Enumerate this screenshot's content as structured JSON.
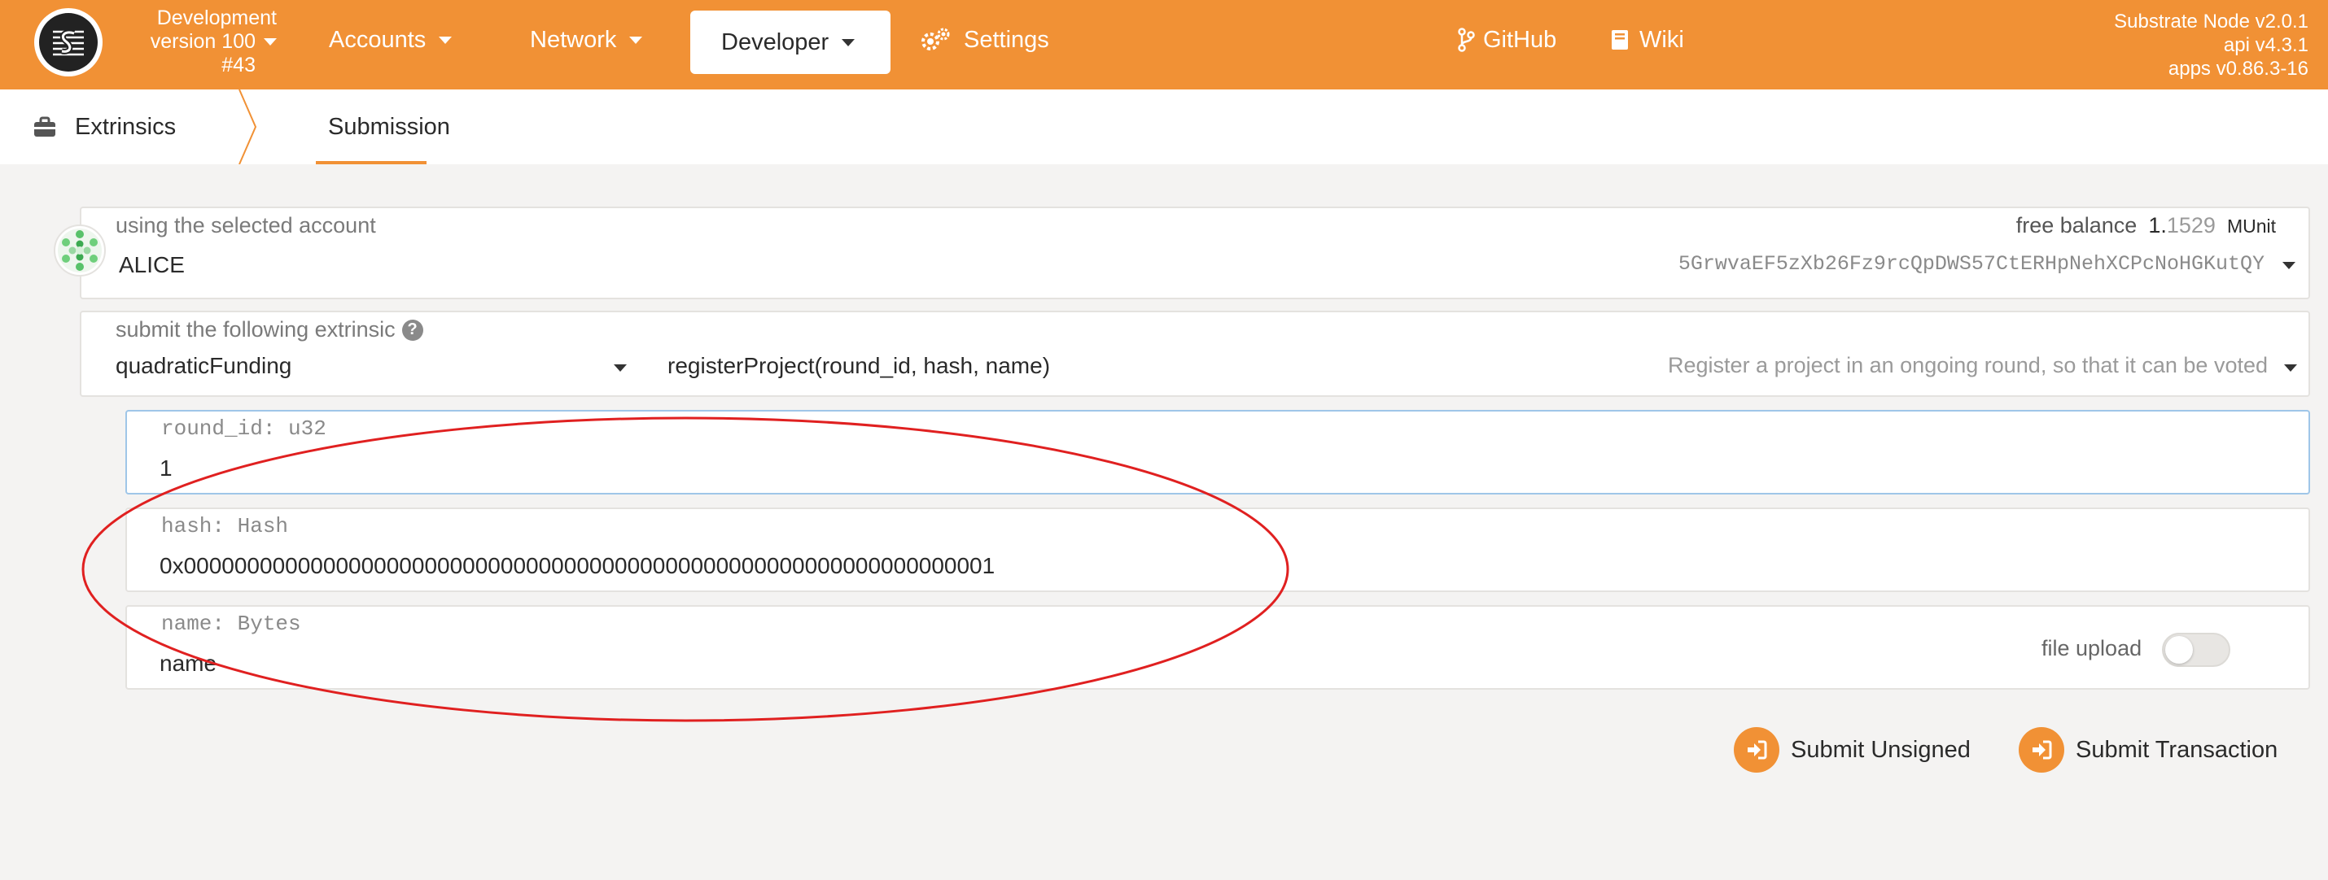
{
  "header": {
    "chain_name": "Development",
    "version_label": "version 100",
    "block_label": "#43",
    "nav": [
      {
        "label": "Accounts"
      },
      {
        "label": "Network"
      },
      {
        "label": "Developer"
      },
      {
        "label": "Settings"
      },
      {
        "label": "GitHub"
      },
      {
        "label": "Wiki"
      }
    ],
    "versions": [
      "Substrate Node v2.0.1",
      "api v4.3.1",
      "apps v0.86.3-16"
    ]
  },
  "subnav": {
    "section": "Extrinsics",
    "tab": "Submission"
  },
  "account": {
    "label": "using the selected account",
    "name": "ALICE",
    "balance_label": "free balance",
    "balance_int": "1.",
    "balance_frac": "1529",
    "balance_unit": "MUnit",
    "address": "5GrwvaEF5zXb26Fz9rcQpDWS57CtERHpNehXCPcNoHGKutQY"
  },
  "extrinsic": {
    "label": "submit the following extrinsic",
    "module": "quadraticFunding",
    "method": "registerProject(round_id, hash, name)",
    "description": "Register a project in an ongoing round, so that it can be voted"
  },
  "params": [
    {
      "label": "round_id: u32",
      "value": "1"
    },
    {
      "label": "hash: Hash",
      "value": "0x0000000000000000000000000000000000000000000000000000000000000001"
    },
    {
      "label": "name: Bytes",
      "value": "name",
      "extra": "file upload"
    }
  ],
  "actions": {
    "submit_unsigned": "Submit Unsigned",
    "submit_transaction": "Submit Transaction"
  },
  "colors": {
    "accent": "#f19135",
    "annotation": "#e02020"
  }
}
